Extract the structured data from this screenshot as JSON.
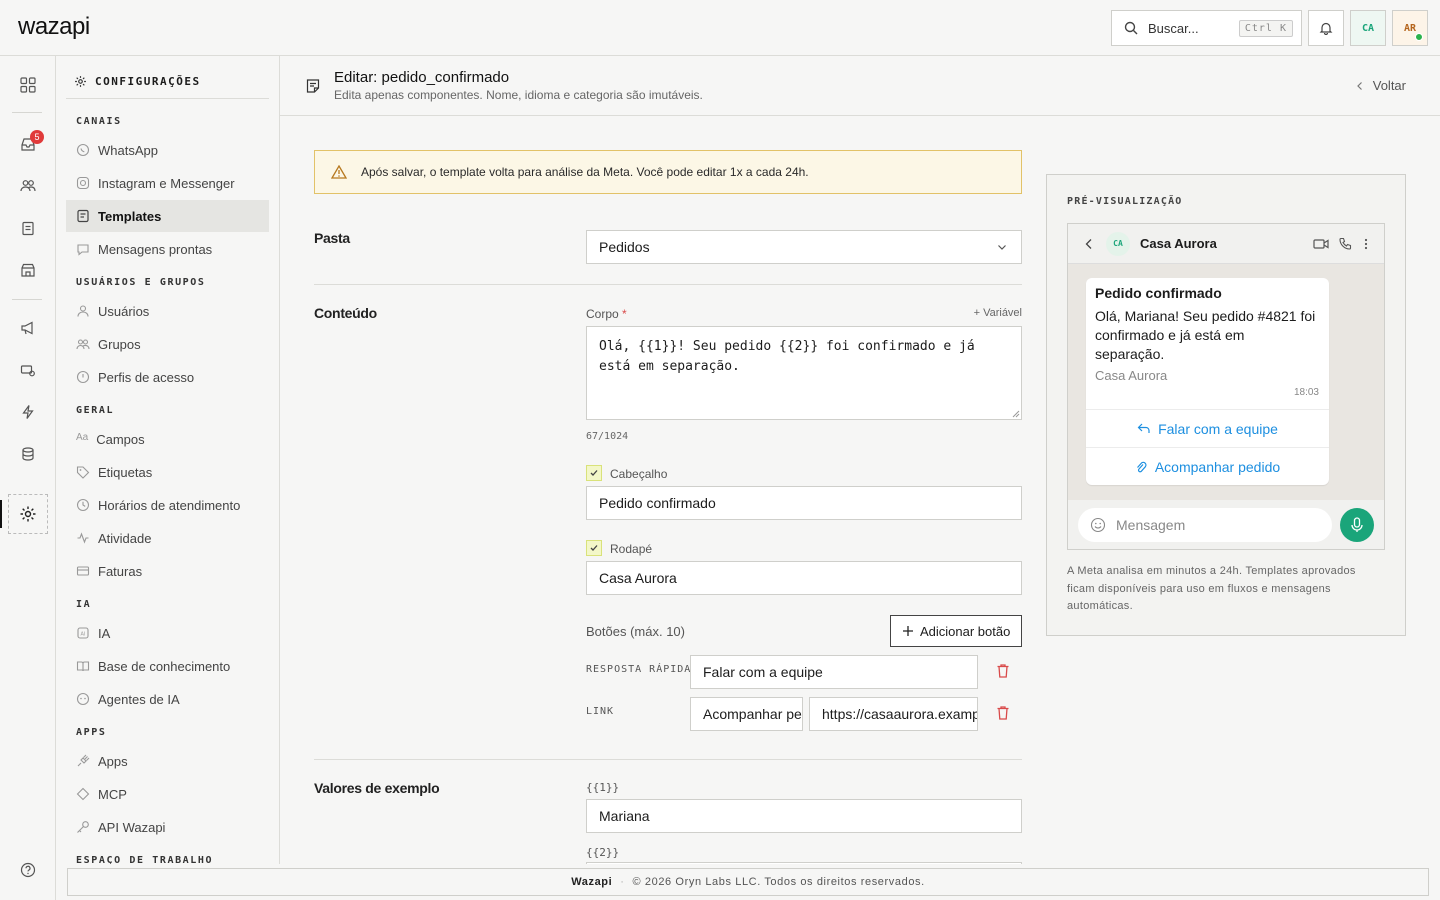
{
  "app": {
    "logo": "wazapi"
  },
  "topbar": {
    "search_placeholder": "Buscar...",
    "search_shortcut": "Ctrl K",
    "avatar_org": "CA",
    "avatar_user": "AR"
  },
  "rail": {
    "inbox_badge": "5"
  },
  "sidebar": {
    "header": "CONFIGURAÇÕES",
    "sections": {
      "canais": "CANAIS",
      "usuarios": "USUÁRIOS E GRUPOS",
      "geral": "GERAL",
      "ia": "IA",
      "apps": "APPS",
      "espaco": "ESPAÇO DE TRABALHO"
    },
    "items": {
      "whatsapp": "WhatsApp",
      "instagram": "Instagram e Messenger",
      "templates": "Templates",
      "mensagens": "Mensagens prontas",
      "usuarios": "Usuários",
      "grupos": "Grupos",
      "perfis": "Perfis de acesso",
      "campos": "Campos",
      "etiquetas": "Etiquetas",
      "horarios": "Horários de atendimento",
      "atividade": "Atividade",
      "faturas": "Faturas",
      "ia": "IA",
      "base": "Base de conhecimento",
      "agentes": "Agentes de IA",
      "apps": "Apps",
      "mcp": "MCP",
      "api": "API Wazapi"
    }
  },
  "header": {
    "title": "Editar: pedido_confirmado",
    "subtitle": "Edita apenas componentes. Nome, idioma e categoria são imutáveis.",
    "back": "Voltar"
  },
  "alert": {
    "text": "Após salvar, o template volta para análise da Meta. Você pode editar 1x a cada 24h."
  },
  "form": {
    "pasta_label": "Pasta",
    "pasta_value": "Pedidos",
    "conteudo_label": "Conteúdo",
    "corpo_label": "Corpo",
    "required_mark": "*",
    "add_variable": "+ Variável",
    "corpo_value": "Olá, {{1}}! Seu pedido {{2}} foi confirmado e já está em separação.",
    "char_count": "67/1024",
    "header_toggle": "Cabeçalho",
    "header_value": "Pedido confirmado",
    "footer_toggle": "Rodapé",
    "footer_value": "Casa Aurora",
    "buttons_label": "Botões (máx. 10)",
    "add_button": "Adicionar botão",
    "btn1_type": "RESPOSTA RÁPIDA",
    "btn1_text": "Falar com a equipe",
    "btn2_type": "LINK",
    "btn2_text": "Acompanhar pedido",
    "btn2_url": "https://casaaurora.example",
    "exemplos_label": "Valores de exemplo",
    "var1_label": "{{1}}",
    "var1_value": "Mariana",
    "var2_label": "{{2}}"
  },
  "preview": {
    "title": "PRÉ-VISUALIZAÇÃO",
    "avatar": "CA",
    "contact": "Casa Aurora",
    "msg_header": "Pedido confirmado",
    "msg_body": "Olá, Mariana! Seu pedido #4821 foi confirmado e já está em separação.",
    "msg_footer": "Casa Aurora",
    "time": "18:03",
    "btn1": "Falar com a equipe",
    "btn2": "Acompanhar pedido",
    "input_placeholder": "Mensagem",
    "note": "A Meta analisa em minutos a 24h. Templates aprovados ficam disponíveis para uso em fluxos e mensagens automáticas."
  },
  "footer": {
    "brand": "Wazapi",
    "copyright": "© 2026 Oryn Labs LLC. Todos os direitos reservados."
  },
  "colors": {
    "accent": "#1aa57a",
    "danger": "#d94a4a",
    "link": "#1d8fe0",
    "alert_bg": "#fcf7e6"
  }
}
